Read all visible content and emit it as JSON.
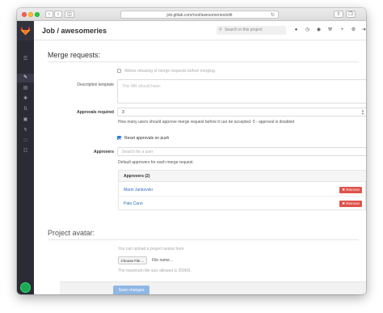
{
  "browser": {
    "url": "job.gitlab.com/root/awesomeries/edit",
    "back_icon": "chevron-left",
    "forward_icon": "chevron-right",
    "sidebar_toggle_icon": "sidebar"
  },
  "header": {
    "title": "Job / awesomeries",
    "search_placeholder": "Search in this project"
  },
  "merge_requests": {
    "section_title": "Merge requests:",
    "rebase_label": "Allows rebasing of merge requests before merging.",
    "rebase_checked": false,
    "description_label": "Description template",
    "description_placeholder": "This MR should have:",
    "approvals_label": "Approvals required",
    "approvals_value": "3",
    "approvals_help": "How many users should approve merge request before it can be accepted. 0 - approval is disabled",
    "reset_label": "Reset approvals on push",
    "reset_checked": true,
    "approvers_label": "Approvers",
    "approvers_placeholder": "Search for a user",
    "approvers_help": "Default approvers for each merge request.",
    "approvers_list_title": "Approvers (2)",
    "approvers": [
      {
        "name": "Marin Jankovski",
        "remove_label": "Remove"
      },
      {
        "name": "Pato Cano",
        "remove_label": "Remove"
      }
    ]
  },
  "avatar": {
    "section_title": "Project avatar:",
    "hint": "You can upload a project avatar here",
    "choose_label": "Choose File ...",
    "file_name": "File name...",
    "max_size": "The maximum file size allowed is 200KB."
  },
  "footer": {
    "save_label": "Save changes"
  },
  "colors": {
    "sidebar": "#2b2b36",
    "accent": "#2f7bd8",
    "danger": "#e0524b",
    "link": "#2f6dc2"
  }
}
